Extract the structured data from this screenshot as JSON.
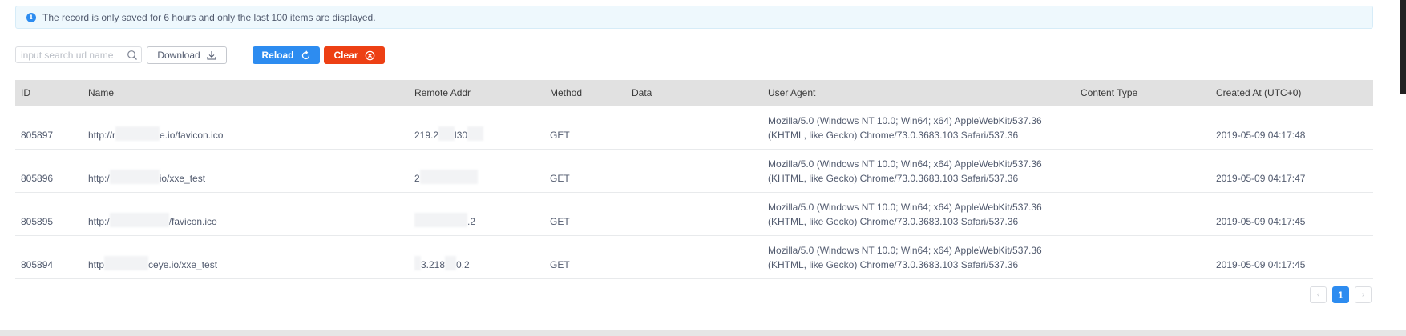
{
  "notice": {
    "text": "The record is only saved for 6 hours and only the last 100 items are displayed."
  },
  "toolbar": {
    "search_placeholder": "input search url name",
    "download_label": "Download",
    "reload_label": "Reload",
    "clear_label": "Clear"
  },
  "table": {
    "headers": {
      "id": "ID",
      "name": "Name",
      "remote_addr": "Remote Addr",
      "method": "Method",
      "data": "Data",
      "user_agent": "User Agent",
      "content_type": "Content Type",
      "created_at": "Created At (UTC+0)"
    },
    "rows": [
      {
        "id": "805897",
        "name_a": "http://r",
        "name_b": "e.io/favicon.ico",
        "addr_a": "219.2",
        "addr_b": "l30",
        "method": "GET",
        "data": "",
        "content_type": "",
        "user_agent": "Mozilla/5.0 (Windows NT 10.0; Win64; x64) AppleWebKit/537.36 (KHTML, like Gecko) Chrome/73.0.3683.103 Safari/537.36",
        "created_at": "2019-05-09 04:17:48"
      },
      {
        "id": "805896",
        "name_a": "http:/",
        "name_b": "io/xxe_test",
        "addr_a": "2",
        "addr_b": "",
        "method": "GET",
        "data": "",
        "content_type": "",
        "user_agent": "Mozilla/5.0 (Windows NT 10.0; Win64; x64) AppleWebKit/537.36 (KHTML, like Gecko) Chrome/73.0.3683.103 Safari/537.36",
        "created_at": "2019-05-09 04:17:47"
      },
      {
        "id": "805895",
        "name_a": "http:/",
        "name_b": "/favicon.ico",
        "addr_a": "",
        "addr_b": ".2",
        "method": "GET",
        "data": "",
        "content_type": "",
        "user_agent": "Mozilla/5.0 (Windows NT 10.0; Win64; x64) AppleWebKit/537.36 (KHTML, like Gecko) Chrome/73.0.3683.103 Safari/537.36",
        "created_at": "2019-05-09 04:17:45"
      },
      {
        "id": "805894",
        "name_a": "http",
        "name_b": "ceye.io/xxe_test",
        "addr_a": "3.218",
        "addr_b": "0.2",
        "method": "GET",
        "data": "",
        "content_type": "",
        "user_agent": "Mozilla/5.0 (Windows NT 10.0; Win64; x64) AppleWebKit/537.36 (KHTML, like Gecko) Chrome/73.0.3683.103 Safari/537.36",
        "created_at": "2019-05-09 04:17:45"
      }
    ]
  },
  "pagination": {
    "prev": "‹",
    "current": "1",
    "next": "›"
  },
  "colors": {
    "primary": "#2d8cf0",
    "danger": "#ed4014",
    "header_bg": "#e1e1e1",
    "notice_bg": "#eef8fd"
  }
}
